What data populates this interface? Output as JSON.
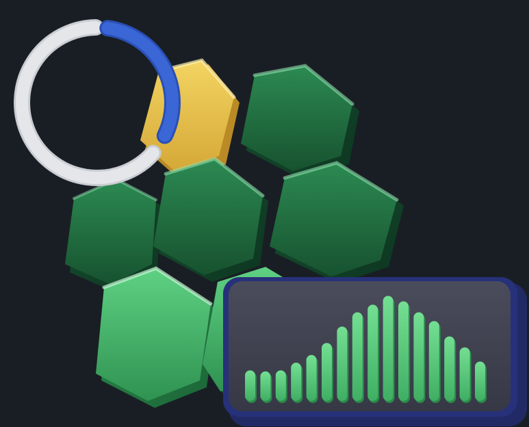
{
  "colors": {
    "background": "#191e24",
    "ring_light": "#e4e6ea",
    "ring_accent": "#3a66d6",
    "hex_yellow": "#e8c24a",
    "hex_dark_green": "#1f6b40",
    "hex_light_green": "#3fae63",
    "panel_face": "#3f4150",
    "panel_edge": "#27317a",
    "bar_green": "#5dd07f"
  },
  "donut": {
    "accent_fraction": 0.3
  },
  "bars": {
    "values": [
      0.28,
      0.27,
      0.28,
      0.35,
      0.42,
      0.53,
      0.68,
      0.81,
      0.88,
      0.96,
      0.91,
      0.81,
      0.73,
      0.59,
      0.49,
      0.36
    ]
  }
}
